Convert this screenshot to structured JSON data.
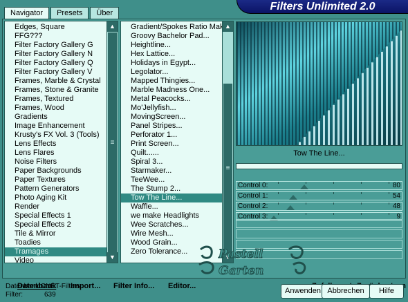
{
  "brand": {
    "title": "Filters Unlimited 2.0"
  },
  "tabs": [
    {
      "label": "Navigator",
      "active": true
    },
    {
      "label": "Presets",
      "active": false
    },
    {
      "label": "Über",
      "active": false
    }
  ],
  "categories": {
    "items": [
      "Edges, Square",
      "FFG???",
      "Filter Factory Gallery G",
      "Filter Factory Gallery N",
      "Filter Factory Gallery Q",
      "Filter Factory Gallery V",
      "Frames, Marble & Crystal",
      "Frames, Stone & Granite",
      "Frames, Textured",
      "Frames, Wood",
      "Gradients",
      "Image Enhancement",
      "Krusty's FX Vol. 3 (Tools)",
      "Lens Effects",
      "Lens Flares",
      "Noise Filters",
      "Paper Backgrounds",
      "Paper Textures",
      "Pattern Generators",
      "Photo Aging Kit",
      "Render",
      "Special Effects 1",
      "Special Effects 2",
      "Tile & Mirror",
      "Toadies",
      "Tramages",
      "Video"
    ],
    "selected": "Tramages"
  },
  "filters": {
    "items": [
      "Gradient/Spokes Ratio Maker...",
      "Groovy Bachelor Pad...",
      "Heightline...",
      "Hex Lattice...",
      "Holidays in Egypt...",
      "Legolator...",
      "Mapped Thingies...",
      "Marble Madness One...",
      "Metal Peacocks...",
      "Mo'Jellyfish...",
      "MovingScreen...",
      "Panel Stripes...",
      "Perforator 1...",
      "Print Screen...",
      "Quilt......",
      "Spiral 3...",
      "Starmaker...",
      "TeeWee...",
      "The Stump 2...",
      "Tow The Line...",
      "Waffle...",
      "we make Headlights",
      "Wee Scratches...",
      "Wire Mesh...",
      "Wood Grain...",
      "Zero Tolerance..."
    ],
    "selected": "Tow The Line..."
  },
  "preview": {
    "label": "Tow The Line..."
  },
  "controls": [
    {
      "label": "Control 0:",
      "value": "80",
      "level": 0.31
    },
    {
      "label": "Control 1:",
      "value": "54",
      "level": 0.21
    },
    {
      "label": "Control 2:",
      "value": "48",
      "level": 0.19
    },
    {
      "label": "Control 3:",
      "value": "9",
      "level": 0.035
    }
  ],
  "menu": {
    "datenbank": "Datenbank",
    "import": "Import...",
    "filter_info": "Filter Info...",
    "editor": "Editor...",
    "zufallswerte": "Zufallswerte",
    "zuruecksetzen": "Zurücksetzen"
  },
  "watermark": {
    "text": "Pastell Garten PSP"
  },
  "status": {
    "datenbank_label": "Datenbank:",
    "datenbank_value": "ICNET-Filters",
    "filter_label": "Filter:",
    "filter_value": "639"
  },
  "buttons": {
    "apply": "Anwenden",
    "cancel": "Abbrechen",
    "help": "Hilfe"
  },
  "colors": {
    "accent": "#2f8a83",
    "brand": "#0b1366",
    "frame": "#4a9d97"
  }
}
